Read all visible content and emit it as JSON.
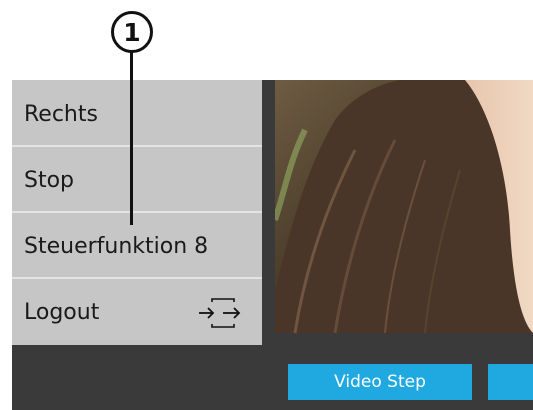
{
  "callout": {
    "number": "1"
  },
  "menu": {
    "items": [
      {
        "label": "Rechts"
      },
      {
        "label": "Stop"
      },
      {
        "label": "Steuerfunktion 8"
      },
      {
        "label": "Logout",
        "icon": "logout-arrows-icon"
      }
    ]
  },
  "video": {
    "content": "camera-feed-image"
  },
  "buttons": {
    "video_step": "Video Step",
    "next": ""
  },
  "colors": {
    "menu_bg": "#c6c6c6",
    "frame_bg": "#3a3a3a",
    "accent_button": "#1fa9e0"
  }
}
